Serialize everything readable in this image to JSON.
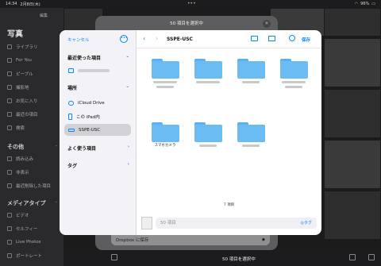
{
  "status": {
    "time": "14:34",
    "date": "2月8日(木)",
    "battery": "96%",
    "wifi_icon": "wifi-icon"
  },
  "photos_sidebar": {
    "top_button": "編集",
    "title": "写真",
    "items": [
      {
        "label": "ライブラリ",
        "icon": "photo-library-icon"
      },
      {
        "label": "For You",
        "icon": "for-you-icon"
      },
      {
        "label": "ピープル",
        "icon": "people-icon"
      },
      {
        "label": "撮影地",
        "icon": "map-pin-icon"
      },
      {
        "label": "お気に入り",
        "icon": "heart-icon"
      },
      {
        "label": "最近の項目",
        "icon": "clock-icon"
      },
      {
        "label": "検索",
        "icon": "search-icon"
      }
    ],
    "other_header": "その他",
    "other_items": [
      {
        "label": "読み込み",
        "icon": "import-icon"
      },
      {
        "label": "非表示",
        "icon": "hidden-icon"
      },
      {
        "label": "最近削除した項目",
        "icon": "trash-icon"
      }
    ],
    "media_header": "メディアタイプ",
    "media_items": [
      {
        "label": "ビデオ",
        "icon": "video-icon"
      },
      {
        "label": "セルフィー",
        "icon": "selfie-icon"
      },
      {
        "label": "Live Photos",
        "icon": "live-photos-icon"
      },
      {
        "label": "ポートレート",
        "icon": "portrait-icon"
      }
    ]
  },
  "back_sheet": {
    "title": "50 項目を選択中",
    "save_row": "Dropbox に保存"
  },
  "bottom_bar": {
    "selection": "50 項目を選択中"
  },
  "picker": {
    "cancel": "キャンセル",
    "recent_header": "最近使った項目",
    "locations_header": "場所",
    "locations": [
      {
        "label": "iCloud Drive",
        "icon": "cloud-icon",
        "selected": false
      },
      {
        "label": "この iPad内",
        "icon": "ipad-icon",
        "selected": false
      },
      {
        "label": "SSPE-USC",
        "icon": "drive-icon",
        "selected": true
      }
    ],
    "favorites_header": "よく使う項目",
    "tags_header": "タグ",
    "current_folder": "SSPE-USC",
    "save": "保存",
    "folders": [
      {
        "label": ""
      },
      {
        "label": ""
      },
      {
        "label": ""
      },
      {
        "label": ""
      },
      {
        "label": "スマホカメラ"
      },
      {
        "label": ""
      },
      {
        "label": ""
      }
    ],
    "item_count": "7 項目",
    "file_field": "50 項目",
    "tags_button": "タグ"
  }
}
